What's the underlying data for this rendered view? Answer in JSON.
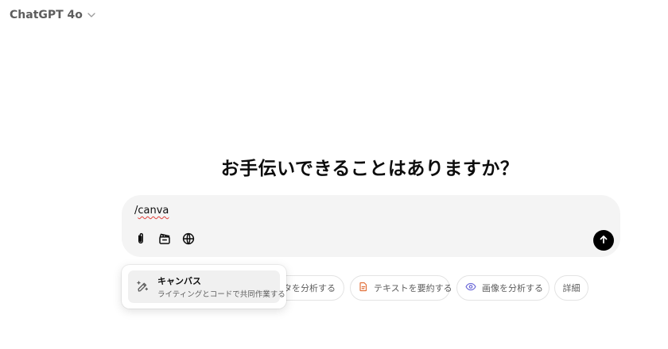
{
  "header": {
    "model_name": "ChatGPT 4o",
    "dropdown_icon": "chevron-down-icon"
  },
  "main": {
    "headline": "お手伝いできることはありますか？"
  },
  "composer": {
    "prefix": "/",
    "typed_word": "canva",
    "tools": [
      {
        "name": "attach",
        "icon": "paperclip-icon"
      },
      {
        "name": "tools",
        "icon": "clapperboard-icon"
      },
      {
        "name": "web-search",
        "icon": "globe-icon"
      }
    ],
    "send_icon": "arrow-up-icon"
  },
  "suggestions": [
    {
      "label": "ータを分析する",
      "icon": ""
    },
    {
      "label": "テキストを要約する",
      "icon": "document-icon",
      "icon_color": "#e2703a"
    },
    {
      "label": "画像を分析する",
      "icon": "eye-icon",
      "icon_color": "#6b68d8"
    },
    {
      "label": "詳細",
      "icon": ""
    }
  ],
  "slash_popup": {
    "items": [
      {
        "title": "キャンバス",
        "description": "ライティングとコードで共同作業する",
        "icon": "pencil-sparkle-icon"
      }
    ]
  },
  "colors": {
    "composer_bg": "#f4f4f4",
    "send_button": "#000000",
    "spellcheck_underline": "#e0413b"
  }
}
